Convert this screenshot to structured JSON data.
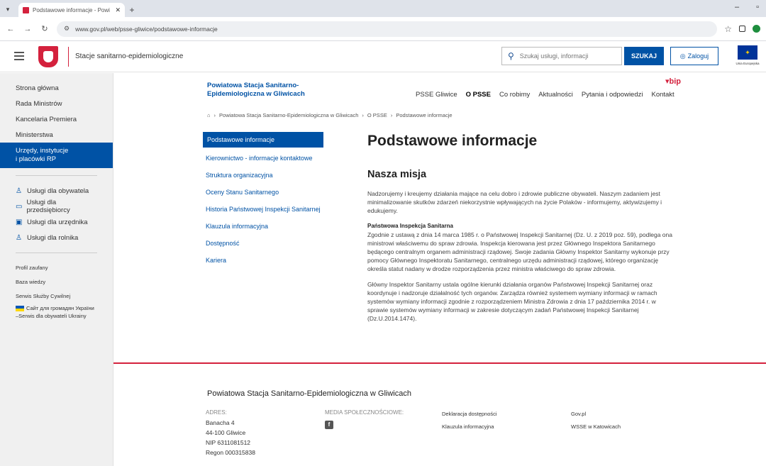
{
  "browser": {
    "tab_title": "Podstawowe informacje - Powi",
    "tab_close": "✕",
    "new_tab": "+",
    "url": "www.gov.pl/web/psse-gliwice/podstawowe-informacje",
    "icons": [
      "back-icon",
      "forward-icon",
      "reload-icon",
      "tune-icon",
      "star-icon",
      "profile-icon"
    ]
  },
  "header": {
    "site_name": "Stacje sanitarno-epidemiologiczne",
    "search_placeholder": "Szukaj usługi, informacji",
    "search_button": "SZUKAJ",
    "login_button": "Zaloguj",
    "eu_label": "Unia Europejska"
  },
  "sidebar": {
    "main_items": [
      "Strona główna",
      "Rada Ministrów",
      "Kancelaria Premiera",
      "Ministerstwa"
    ],
    "active_item": [
      "Urzędy, instytucje",
      "i placówki RP"
    ],
    "services": [
      {
        "label": "Usługi dla obywatela",
        "icon": "person-icon"
      },
      {
        "label": "Usługi dla przedsiębiorcy",
        "icon": "briefcase-icon"
      },
      {
        "label": "Usługi dla urzędnika",
        "icon": "monitor-icon"
      },
      {
        "label": "Usługi dla rolnika",
        "icon": "person-icon"
      }
    ],
    "small_items": [
      "Profil zaufany",
      "Baza wiedzy",
      "Serwis Służby Cywilnej"
    ],
    "ukraine": [
      "Сайт для громадян України",
      "–Serwis dla obywateli Ukrainy"
    ]
  },
  "bip": {
    "org_name": "Powiatowa Stacja Sanitarno-Epidemiologiczna w Gliwicach",
    "logo": "bip",
    "nav": [
      "PSSE Gliwice",
      "O PSSE",
      "Co robimy",
      "Aktualności",
      "Pytania i odpowiedzi",
      "Kontakt"
    ],
    "nav_current": "O PSSE"
  },
  "breadcrumb": [
    "Powiatowa Stacja Sanitarno-Epidemiologiczna w Gliwicach",
    "O PSSE",
    "Podstawowe informacje"
  ],
  "left_nav": {
    "active": "Podstawowe informacje",
    "items": [
      "Kierownictwo - informacje kontaktowe",
      "Struktura organizacyjna",
      "Oceny Stanu Sanitarnego",
      "Historia Państwowej Inspekcji Sanitarnej",
      "Klauzula informacyjna",
      "Dostępność",
      "Kariera"
    ]
  },
  "main": {
    "title": "Podstawowe informacje",
    "section_title": "Nasza misja",
    "mission_text": "Nadzorujemy i kreujemy działania mające na celu dobro i zdrowie publiczne obywateli. Naszym zadaniem jest minimalizowanie skutków zdarzeń niekorzystnie wpływających na życie Polaków - informujemy, aktywizujemy i edukujemy.",
    "subheading": "Państwowa Inspekcja Sanitarna",
    "para1": "Zgodnie z ustawą z dnia 14 marca 1985 r. o Państwowej Inspekcji Sanitarnej (Dz. U. z 2019 poz. 59), podlega ona ministrowi właściwemu do spraw zdrowia. Inspekcja kierowana jest przez Głównego Inspektora Sanitarnego będącego centralnym organem administracji rządowej. Swoje zadania Główny Inspektor Sanitarny wykonuje przy pomocy Głównego Inspektoratu Sanitarnego, centralnego urzędu administracji rządowej, którego organizację określa statut nadany w drodze rozporządzenia przez ministra właściwego do spraw zdrowia.",
    "para2": "Główny Inspektor Sanitarny ustala ogólne kierunki działania organów Państwowej Inspekcji Sanitarnej oraz koordynuje i nadzoruje działalność tych organów. Zarządza również systemem wymiany informacji w ramach systemów wymiany informacji zgodnie z rozporządzeniem Ministra Zdrowia z dnia 17 października 2014 r. w sprawie systemów wymiany informacji w zakresie dotyczącym zadań Państwowej Inspekcji Sanitarnej (Dz.U.2014.1474)."
  },
  "footer": {
    "org_name": "Powiatowa Stacja Sanitarno-Epidemiologiczna w Gliwicach",
    "address_caption": "ADRES:",
    "address": [
      "Banacha 4",
      "44-100 Gliwice",
      "NIP 6311081512",
      "Regon 000315838"
    ],
    "social_caption": "MEDIA SPOŁECZNOŚCIOWE:",
    "social_icon": "facebook-icon",
    "links_col1": [
      "Deklaracja dostępności",
      "Klauzula informacyjna"
    ],
    "links_col2": [
      "Gov.pl",
      "WSSE w Katowicach"
    ]
  }
}
